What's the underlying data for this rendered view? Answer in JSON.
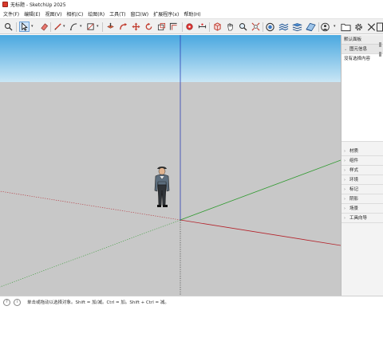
{
  "window": {
    "title": "无标题 - SketchUp 2025"
  },
  "menu": [
    "文件(F)",
    "编辑(E)",
    "视图(V)",
    "相机(C)",
    "绘图(R)",
    "工具(T)",
    "窗口(W)",
    "扩展程序(x)",
    "帮助(H)"
  ],
  "toolbar": {
    "tools": [
      "search-icon",
      "select-arrow-icon",
      "eraser-icon",
      "pencil-line-icon",
      "arc-icon",
      "rectangle-icon",
      "push-pull-icon",
      "follow-me-icon",
      "move-icon",
      "rotate-icon",
      "scale-icon",
      "offset-icon",
      "tape-measure-icon",
      "dimension-icon",
      "orbit-icon",
      "zoom-icon",
      "zoom-extents-icon",
      "solid-tools-icon",
      "sandbox-icon",
      "layers-icon",
      "style-icon",
      "warehouse-icon",
      "folder-icon",
      "gear-icon",
      "close-icon",
      "panel-icon"
    ],
    "right_group": [
      "folder-icon",
      "gear-icon",
      "close-icon",
      "panel-icon"
    ]
  },
  "viewport": {
    "sky_top": "#4aa8e0",
    "sky_bottom": "#c9e6f5",
    "ground": "#c8c8c8",
    "axis_colors": {
      "red": "#b4222a",
      "green": "#2f9a2f",
      "blue": "#2b3fb5"
    }
  },
  "panel": {
    "title": "默认面板",
    "entity_info": {
      "label": "图元信息",
      "content": "没有选择内容"
    },
    "sections": [
      "材质",
      "组件",
      "样式",
      "环境",
      "标记",
      "阴影",
      "场景",
      "工具向导"
    ]
  },
  "status": {
    "hint": "单击或拖动以选择对象。Shift = 加/减。Ctrl = 加。Shift + Ctrl = 减。"
  }
}
